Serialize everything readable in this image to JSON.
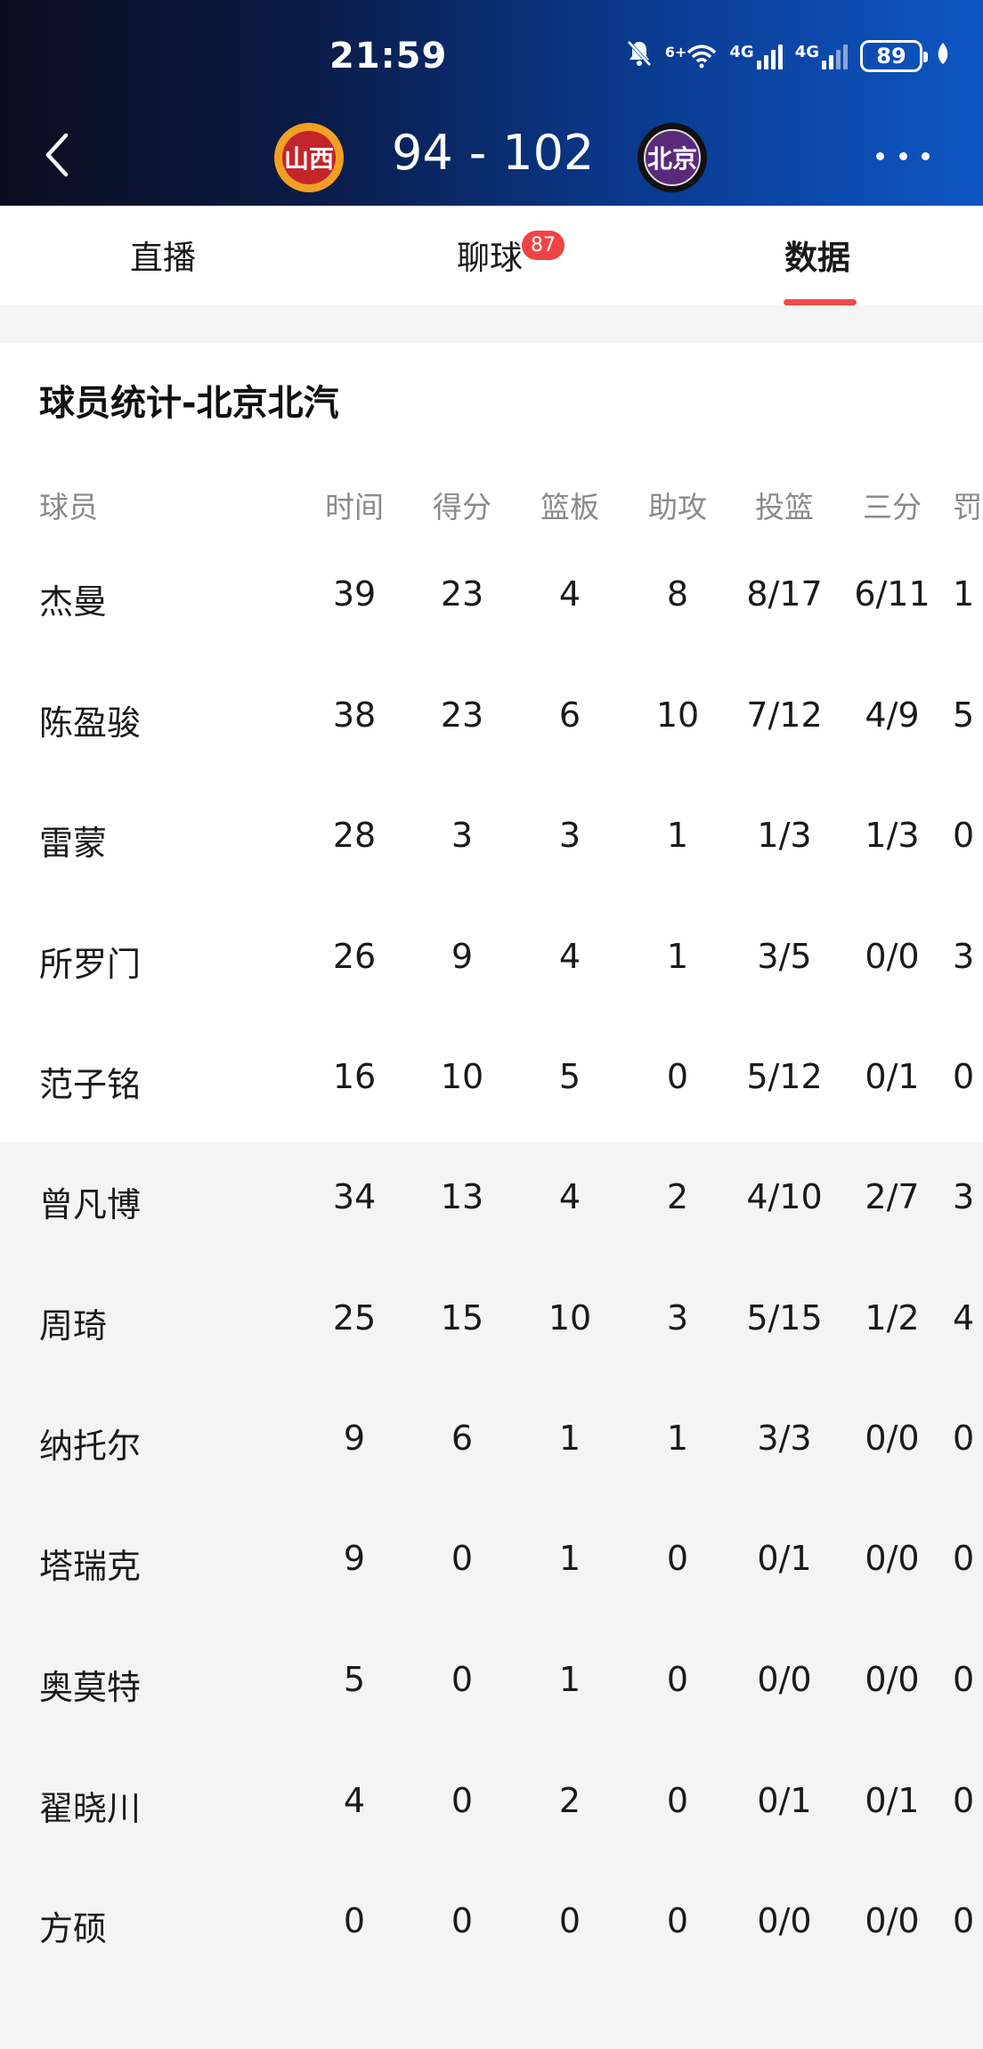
{
  "status_bar": {
    "time": "21:59",
    "net1": "6+",
    "net2": "4G",
    "net3": "4G",
    "battery": "89"
  },
  "match": {
    "home_logo_text": "山西",
    "home_score": "94",
    "separator": "-",
    "away_score": "102",
    "away_logo_text": "北京"
  },
  "tabs": [
    {
      "label": "直播"
    },
    {
      "label": "聊球",
      "badge": "87"
    },
    {
      "label": "数据"
    }
  ],
  "section": {
    "title": "球员统计-北京北汽"
  },
  "table": {
    "headers": [
      "球员",
      "时间",
      "得分",
      "篮板",
      "助攻",
      "投篮",
      "三分",
      "罚"
    ],
    "rows": [
      [
        "杰曼",
        "39",
        "23",
        "4",
        "8",
        "8/17",
        "6/11",
        "1"
      ],
      [
        "陈盈骏",
        "38",
        "23",
        "6",
        "10",
        "7/12",
        "4/9",
        "5"
      ],
      [
        "雷蒙",
        "28",
        "3",
        "3",
        "1",
        "1/3",
        "1/3",
        "0"
      ],
      [
        "所罗门",
        "26",
        "9",
        "4",
        "1",
        "3/5",
        "0/0",
        "3"
      ],
      [
        "范子铭",
        "16",
        "10",
        "5",
        "0",
        "5/12",
        "0/1",
        "0"
      ],
      [
        "曾凡博",
        "34",
        "13",
        "4",
        "2",
        "4/10",
        "2/7",
        "3"
      ],
      [
        "周琦",
        "25",
        "15",
        "10",
        "3",
        "5/15",
        "1/2",
        "4"
      ],
      [
        "纳托尔",
        "9",
        "6",
        "1",
        "1",
        "3/3",
        "0/0",
        "0"
      ],
      [
        "塔瑞克",
        "9",
        "0",
        "1",
        "0",
        "0/1",
        "0/0",
        "0"
      ],
      [
        "奥莫特",
        "5",
        "0",
        "1",
        "0",
        "0/0",
        "0/0",
        "0"
      ],
      [
        "翟晓川",
        "4",
        "0",
        "2",
        "0",
        "0/1",
        "0/1",
        "0"
      ],
      [
        "方硕",
        "0",
        "0",
        "0",
        "0",
        "0/0",
        "0/0",
        "0"
      ]
    ]
  }
}
